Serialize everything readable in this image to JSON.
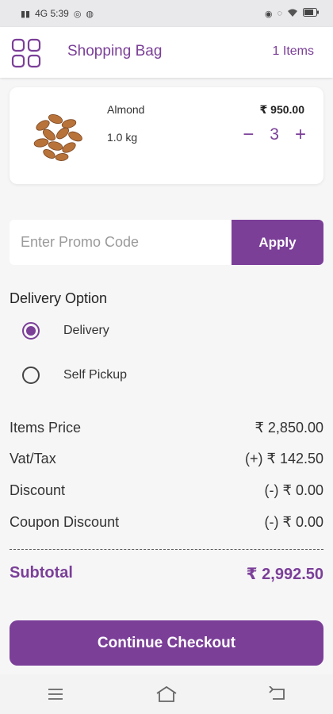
{
  "status_bar": {
    "left_text": "4G 5:39",
    "right_text": ""
  },
  "app_bar": {
    "title": "Shopping Bag",
    "items_count": "1 Items",
    "menu_icon": "grid-icon"
  },
  "cart": {
    "items": [
      {
        "name": "Almond",
        "weight": "1.0 kg",
        "price": "₹ 950.00",
        "quantity": "3",
        "minus": "−",
        "plus": "+"
      }
    ]
  },
  "promo": {
    "placeholder": "Enter Promo Code",
    "value": "",
    "apply_label": "Apply"
  },
  "delivery": {
    "title": "Delivery Option",
    "options": [
      {
        "label": "Delivery",
        "selected": true
      },
      {
        "label": "Self Pickup",
        "selected": false
      }
    ]
  },
  "summary": {
    "rows": [
      {
        "label": "Items Price",
        "value": "₹ 2,850.00"
      },
      {
        "label": "Vat/Tax",
        "value": "(+) ₹ 142.50"
      },
      {
        "label": "Discount",
        "value": "(-) ₹ 0.00"
      },
      {
        "label": "Coupon Discount",
        "value": "(-) ₹ 0.00"
      }
    ],
    "subtotal_label": "Subtotal",
    "subtotal_value": "₹ 2,992.50"
  },
  "checkout_label": "Continue Checkout",
  "colors": {
    "accent": "#7b3f98",
    "background": "#f6f6f7",
    "card": "#ffffff"
  },
  "nav_icons": [
    "menu-icon",
    "home-icon",
    "back-icon"
  ]
}
